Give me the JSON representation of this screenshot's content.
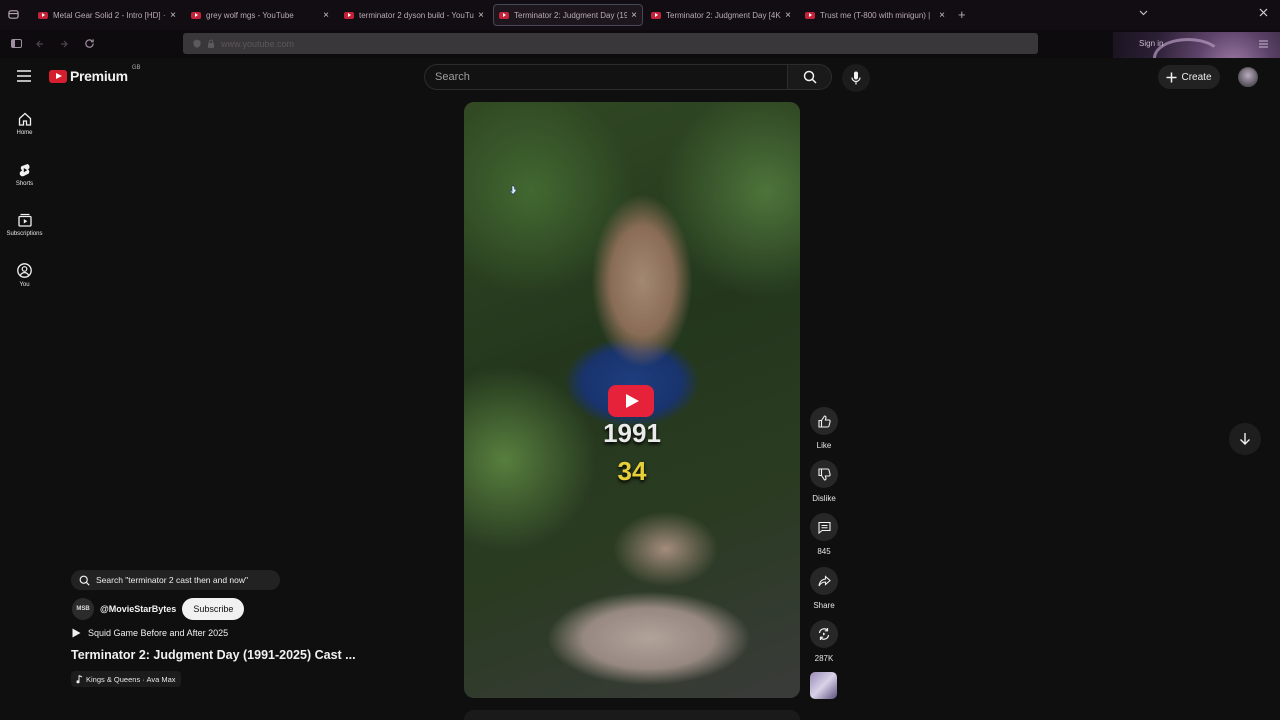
{
  "browser": {
    "tabs": [
      {
        "title": "Metal Gear Solid 2 - Intro [HD] ·",
        "close": "×",
        "active": false
      },
      {
        "title": "grey wolf mgs - YouTube",
        "close": "×",
        "active": false
      },
      {
        "title": "terminator 2 dyson build - YouTube",
        "close": "×",
        "active": false
      },
      {
        "title": "Terminator 2: Judgment Day (19",
        "close": "×",
        "active": true
      },
      {
        "title": "Terminator 2: Judgment Day [4K",
        "close": "×",
        "active": false
      },
      {
        "title": "Trust me (T-800 with minigun) |",
        "close": "×",
        "active": false
      }
    ],
    "new_tab": "+",
    "sign_in": "Sign in",
    "url": "www.youtube.com"
  },
  "youtube": {
    "logo_word": "Premium",
    "country_code": "GB",
    "search_placeholder": "Search",
    "create_label": "Create",
    "sidebar": [
      {
        "label": "Home",
        "icon": "home-icon"
      },
      {
        "label": "Shorts",
        "icon": "shorts-icon"
      },
      {
        "label": "Subscriptions",
        "icon": "subscriptions-icon"
      },
      {
        "label": "You",
        "icon": "you-icon"
      }
    ]
  },
  "short": {
    "overlay_year": "1991",
    "overlay_age": "34",
    "actions": {
      "like_label": "Like",
      "dislike_label": "Dislike",
      "comments_count": "845",
      "share_label": "Share",
      "remix_count": "287K"
    },
    "search_suggestion": "Search \"terminator 2 cast then and now\"",
    "channel_avatar_text": "MSB",
    "channel_handle": "@MovieStarBytes",
    "subscribe_label": "Subscribe",
    "playlist_label": "Squid Game Before and After 2025",
    "title": "Terminator 2: Judgment Day (1991-2025) Cast ...",
    "music": "Kings & Queens · Ava Max"
  },
  "colors": {
    "accent_red": "#e5223a",
    "age_yellow": "#e6cf39",
    "background": "#0f0f0f"
  }
}
